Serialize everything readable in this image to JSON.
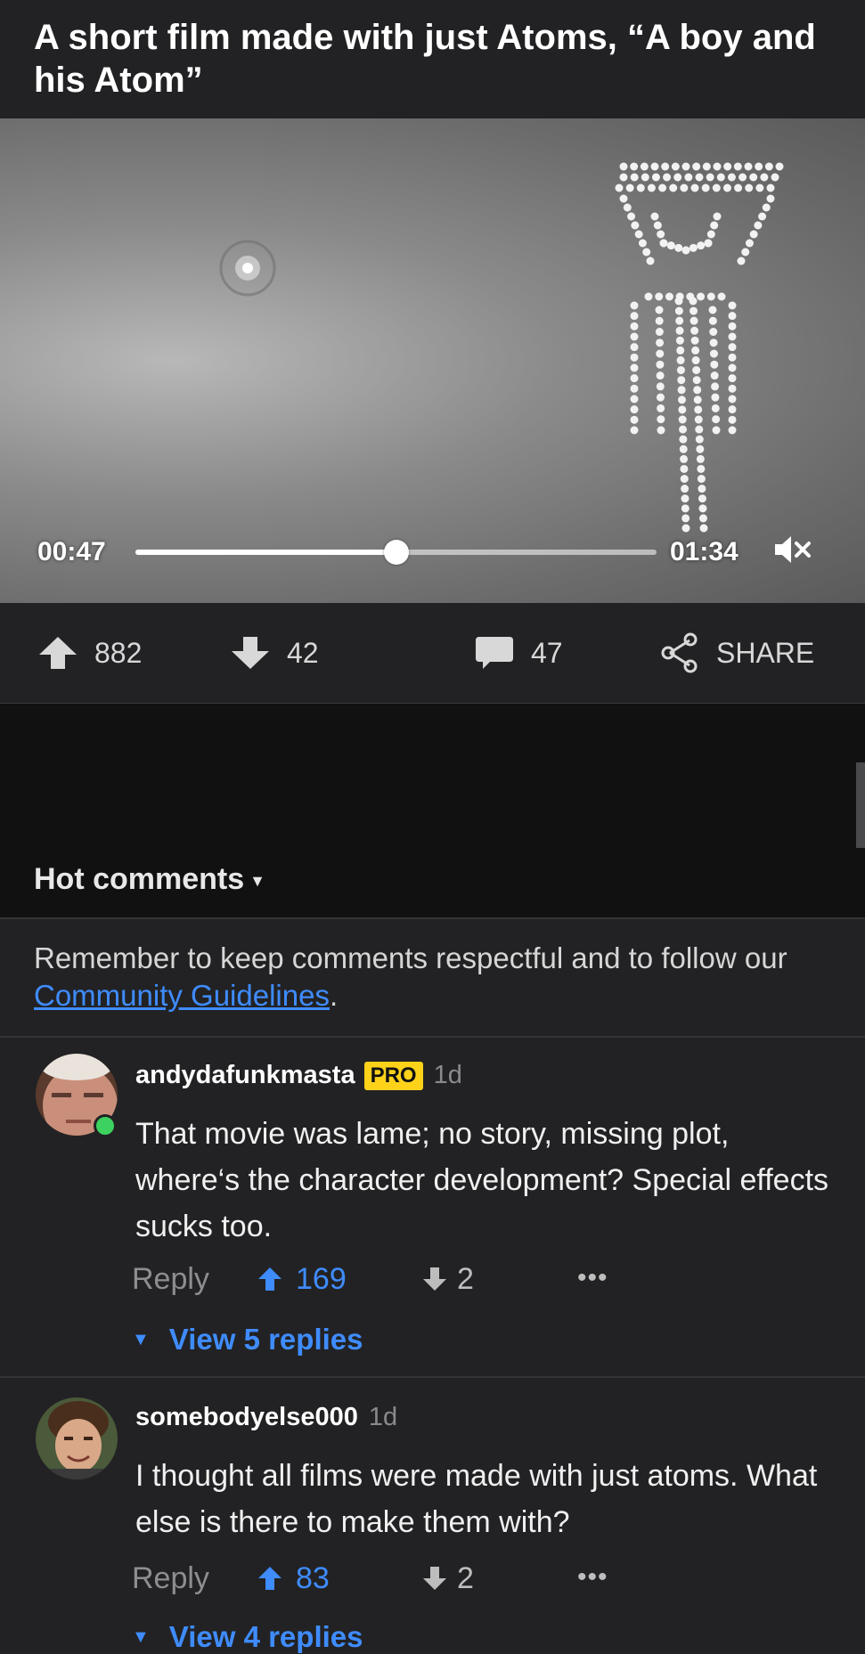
{
  "post": {
    "title": "A short film made with just Atoms, “A boy and his Atom”"
  },
  "video": {
    "current_time": "00:47",
    "duration": "01:34",
    "progress_fraction": 0.5,
    "muted": true
  },
  "actions": {
    "upvotes": "882",
    "downvotes": "42",
    "comments": "47",
    "share_label": "SHARE"
  },
  "comments_section": {
    "sort_label": "Hot comments",
    "notice_text": "Remember to keep comments respectful and to follow our ",
    "notice_link": "Community Guidelines",
    "notice_end": "."
  },
  "comments": [
    {
      "username": "andydafunkmasta",
      "badge": "PRO",
      "age": "1d",
      "text": "That movie was lame; no story, missing plot, where‘s the character development? Special effects sucks too.",
      "reply_label": "Reply",
      "upvotes": "169",
      "downvotes": "2",
      "more": "•••",
      "view_replies": "View 5 replies",
      "online": true
    },
    {
      "username": "somebodyelse000",
      "age": "1d",
      "text": "I thought all films were made with just atoms. What else is there to make them with?",
      "reply_label": "Reply",
      "upvotes": "83",
      "downvotes": "2",
      "more": "•••",
      "view_replies": "View 4 replies"
    }
  ],
  "colors": {
    "accent": "#3f8cff",
    "pro_badge": "#ffd21a",
    "online": "#3dd25f",
    "background": "#222224"
  }
}
